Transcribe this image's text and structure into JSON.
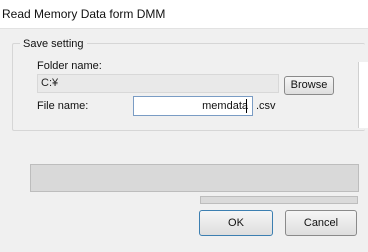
{
  "window": {
    "title": "Read Memory Data form DMM"
  },
  "save_setting": {
    "legend": "Save setting",
    "folder_label": "Folder name:",
    "folder_value": "C:¥",
    "browse_label": "Browse",
    "file_label": "File name:",
    "file_value": "memdata",
    "extension": ".csv"
  },
  "progress": {
    "main_fraction": 0.0,
    "sub_fraction": 0.0
  },
  "buttons": {
    "ok_label": "OK",
    "cancel_label": "Cancel"
  },
  "colors": {
    "ok_border": "#3c7fb1",
    "field_border": "#7a9cc4"
  }
}
